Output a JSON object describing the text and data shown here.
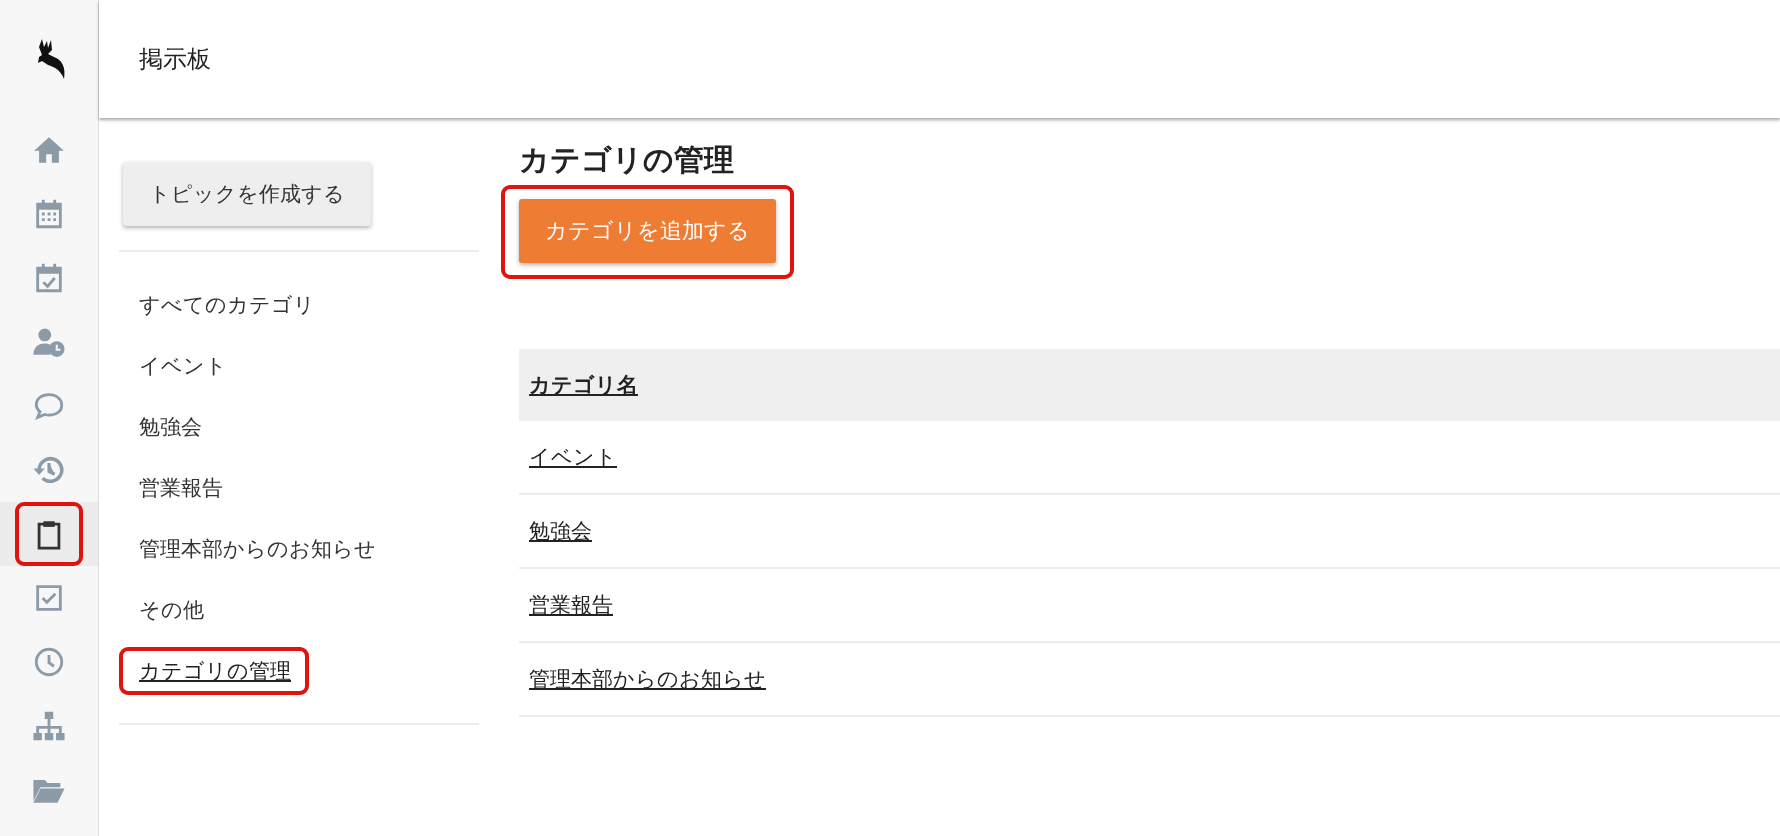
{
  "header": {
    "title": "掲示板"
  },
  "rail": [
    {
      "selected": false,
      "highlighted": false
    },
    {
      "selected": false,
      "highlighted": false
    },
    {
      "selected": false,
      "highlighted": false
    },
    {
      "selected": false,
      "highlighted": false
    },
    {
      "selected": false,
      "highlighted": false
    },
    {
      "selected": false,
      "highlighted": false
    },
    {
      "selected": true,
      "highlighted": true
    },
    {
      "selected": false,
      "highlighted": false
    },
    {
      "selected": false,
      "highlighted": false
    },
    {
      "selected": false,
      "highlighted": false
    },
    {
      "selected": false,
      "highlighted": false
    }
  ],
  "sidebar": {
    "create_button": "トピックを作成する",
    "items": [
      {
        "label": "すべてのカテゴリ",
        "selected": false,
        "highlighted": false
      },
      {
        "label": "イベント",
        "selected": false,
        "highlighted": false
      },
      {
        "label": "勉強会",
        "selected": false,
        "highlighted": false
      },
      {
        "label": "営業報告",
        "selected": false,
        "highlighted": false
      },
      {
        "label": "管理本部からのお知らせ",
        "selected": false,
        "highlighted": false
      },
      {
        "label": "その他",
        "selected": false,
        "highlighted": false
      },
      {
        "label": "カテゴリの管理",
        "selected": true,
        "highlighted": true
      }
    ]
  },
  "main": {
    "title": "カテゴリの管理",
    "add_button": {
      "label": "カテゴリを追加する",
      "highlighted": true
    },
    "table": {
      "columns": [
        "カテゴリ名"
      ],
      "rows": [
        "イベント",
        "勉強会",
        "営業報告",
        "管理本部からのお知らせ"
      ]
    }
  }
}
